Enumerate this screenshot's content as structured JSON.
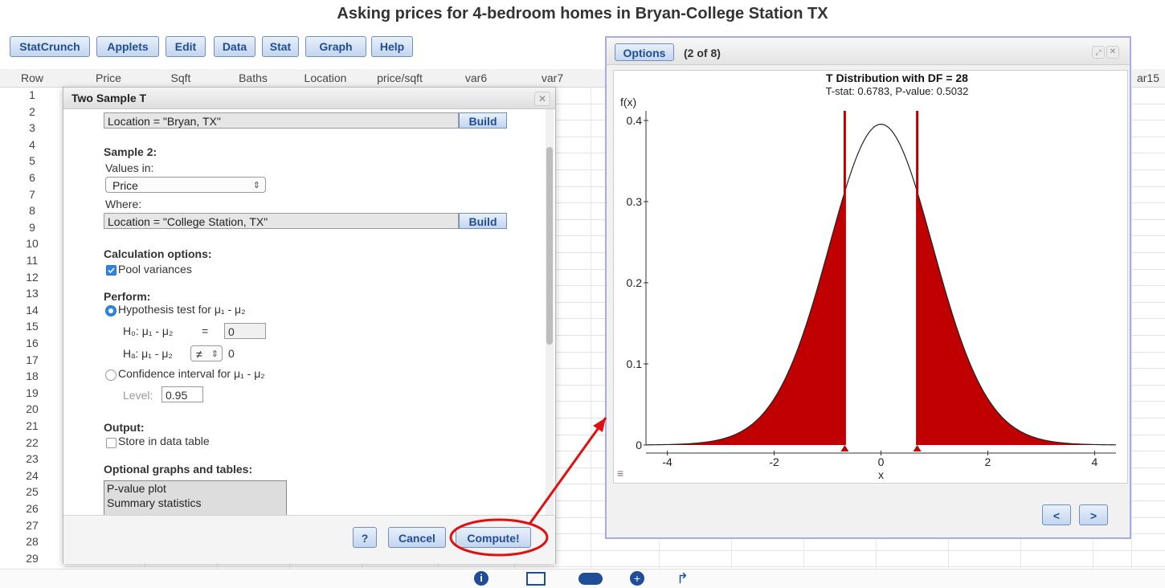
{
  "page_title": "Asking prices for 4-bedroom homes in Bryan-College Station TX",
  "menu": [
    "StatCrunch",
    "Applets",
    "Edit",
    "Data",
    "Stat",
    "Graph",
    "Help"
  ],
  "sheet": {
    "row_header": "Row",
    "columns": [
      "Price",
      "Sqft",
      "Baths",
      "Location",
      "price/sqft",
      "var6",
      "var7"
    ],
    "right_column": "ar15",
    "rows": [
      "1",
      "2",
      "3",
      "4",
      "5",
      "6",
      "7",
      "8",
      "9",
      "10",
      "11",
      "12",
      "13",
      "14",
      "15",
      "16",
      "17",
      "18",
      "19",
      "20",
      "21",
      "22",
      "23",
      "24",
      "25",
      "26",
      "27",
      "28",
      "29"
    ]
  },
  "dialog": {
    "title": "Two Sample T",
    "sample1_where": "Location = \"Bryan, TX\"",
    "build_label": "Build",
    "sample2_heading": "Sample 2:",
    "values_in_label": "Values in:",
    "values_in_selected": "Price",
    "where_label": "Where:",
    "sample2_where": "Location = \"College Station, TX\"",
    "calc_heading": "Calculation options:",
    "pool_label": "Pool variances",
    "pool_checked": true,
    "perform_heading": "Perform:",
    "hyp_label": "Hypothesis test for μ₁ - μ₂",
    "h0_label": "H₀: μ₁ - μ₂",
    "h0_eq": "=",
    "h0_value": "0",
    "ha_label": "Hₐ: μ₁ - μ₂",
    "ha_op": "≠",
    "ha_value": "0",
    "ci_label": "Confidence interval for μ₁ - μ₂",
    "level_label": "Level:",
    "level_value": "0.95",
    "output_heading": "Output:",
    "store_label": "Store in data table",
    "graphs_heading": "Optional graphs and tables:",
    "graphs_options": [
      "P-value plot",
      "Summary statistics"
    ],
    "help_label": "?",
    "cancel_label": "Cancel",
    "compute_label": "Compute!"
  },
  "graph_window": {
    "options_label": "Options",
    "counter": "(2 of 8)",
    "prev_label": "<",
    "next_label": ">",
    "menu_glyph": "≡"
  },
  "chart_data": {
    "type": "area",
    "title": "T Distribution with DF = 28",
    "subtitle": "T-stat: 0.6783, P-value: 0.5032",
    "xlabel": "x",
    "ylabel": "f(x)",
    "df": 28,
    "t_stat": 0.6783,
    "xlim": [
      -4.4,
      4.4
    ],
    "ylim": [
      0,
      0.4
    ],
    "x_ticks": [
      "-4",
      "-2",
      "0",
      "2",
      "4"
    ],
    "y_ticks": [
      "0",
      "0.1",
      "0.2",
      "0.3",
      "0.4"
    ],
    "shaded_regions": [
      [
        -4.4,
        -0.6783
      ],
      [
        0.6783,
        4.4
      ]
    ],
    "fill_color": "#c00000",
    "curve_color": "#222222",
    "grid": false
  }
}
